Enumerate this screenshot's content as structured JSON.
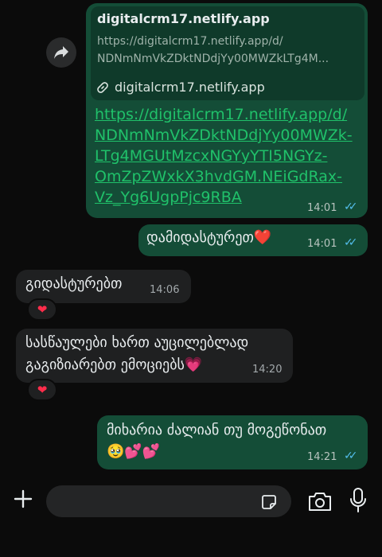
{
  "link_preview": {
    "title": "digitalcrm17.netlify.app",
    "url_line1": "https://digitalcrm17.netlify.app/d/",
    "url_line2": "NDNmNmVkZDktNDdjYy00MWZkLTg4M...",
    "domain": "digitalcrm17.netlify.app"
  },
  "messages": [
    {
      "direction": "outgoing",
      "text": "https://digitalcrm17.netlify.app/d/NDNmNmVkZDktNDdjYy00MWZk-LTg4MGUtMzcxNGYyYTI5NGYz-OmZpZWxkX3hvdGM.NEiGdRax-Vz_Yg6UgpPjc9RBA",
      "time": "14:01",
      "read": true
    },
    {
      "direction": "outgoing",
      "text": "დამიდასტურეთ❤️",
      "time": "14:01",
      "read": true
    },
    {
      "direction": "incoming",
      "text": "გიდასტურებთ",
      "time": "14:06",
      "reaction": "❤"
    },
    {
      "direction": "incoming",
      "text_line1": "სასწაულები ხართ აუცილებლად",
      "text_line2": "გაგიზიარებთ ემოციებს💗",
      "time": "14:20",
      "reaction": "❤"
    },
    {
      "direction": "outgoing",
      "text_line1": "მიხარია ძალიან თუ მოგეწონათ",
      "text_line2": "🥹💕💕",
      "time": "14:21",
      "read": true
    }
  ],
  "url_lines": [
    "https://digitalcrm17.netlify.app/d/",
    "NDNmNmVkZDktNDdjYy00MWZk-",
    "LTg4MGUtMzcxNGYyYTI5NGYz-",
    "OmZpZWxkX3hvdGM.NEiGdRax-",
    "Vz_Yg6UgpPjc9RBA"
  ],
  "icons": {
    "share": "share-icon",
    "link": "link-icon",
    "read_receipt": "double-check-icon",
    "plus": "plus-icon",
    "sticker": "sticker-icon",
    "camera": "camera-icon",
    "mic": "microphone-icon"
  },
  "colors": {
    "outgoing_bubble": "#144d37",
    "incoming_bubble": "#1f2021",
    "link": "#20c16a",
    "read_tick": "#53bdeb"
  }
}
